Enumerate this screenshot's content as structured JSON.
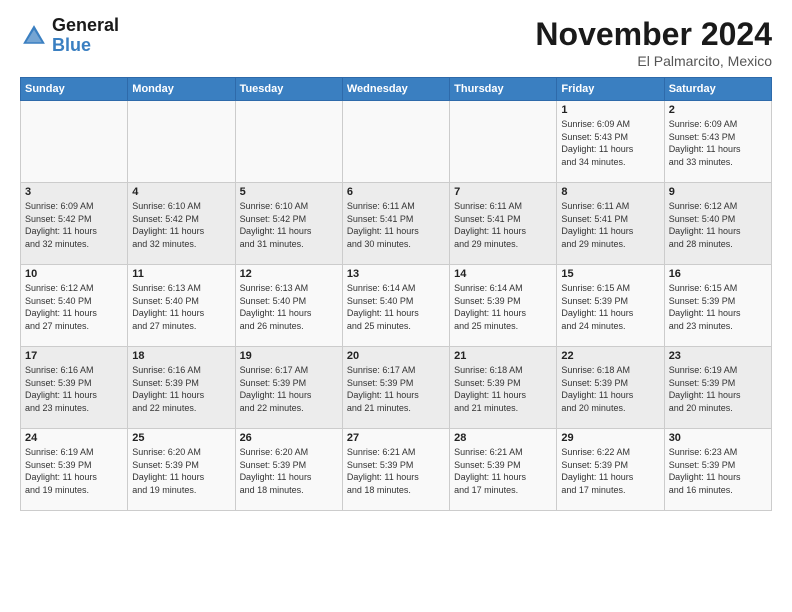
{
  "header": {
    "logo": {
      "line1": "General",
      "line2": "Blue"
    },
    "title": "November 2024",
    "subtitle": "El Palmarcito, Mexico"
  },
  "weekdays": [
    "Sunday",
    "Monday",
    "Tuesday",
    "Wednesday",
    "Thursday",
    "Friday",
    "Saturday"
  ],
  "weeks": [
    [
      {
        "day": "",
        "info": ""
      },
      {
        "day": "",
        "info": ""
      },
      {
        "day": "",
        "info": ""
      },
      {
        "day": "",
        "info": ""
      },
      {
        "day": "",
        "info": ""
      },
      {
        "day": "1",
        "info": "Sunrise: 6:09 AM\nSunset: 5:43 PM\nDaylight: 11 hours\nand 34 minutes."
      },
      {
        "day": "2",
        "info": "Sunrise: 6:09 AM\nSunset: 5:43 PM\nDaylight: 11 hours\nand 33 minutes."
      }
    ],
    [
      {
        "day": "3",
        "info": "Sunrise: 6:09 AM\nSunset: 5:42 PM\nDaylight: 11 hours\nand 32 minutes."
      },
      {
        "day": "4",
        "info": "Sunrise: 6:10 AM\nSunset: 5:42 PM\nDaylight: 11 hours\nand 32 minutes."
      },
      {
        "day": "5",
        "info": "Sunrise: 6:10 AM\nSunset: 5:42 PM\nDaylight: 11 hours\nand 31 minutes."
      },
      {
        "day": "6",
        "info": "Sunrise: 6:11 AM\nSunset: 5:41 PM\nDaylight: 11 hours\nand 30 minutes."
      },
      {
        "day": "7",
        "info": "Sunrise: 6:11 AM\nSunset: 5:41 PM\nDaylight: 11 hours\nand 29 minutes."
      },
      {
        "day": "8",
        "info": "Sunrise: 6:11 AM\nSunset: 5:41 PM\nDaylight: 11 hours\nand 29 minutes."
      },
      {
        "day": "9",
        "info": "Sunrise: 6:12 AM\nSunset: 5:40 PM\nDaylight: 11 hours\nand 28 minutes."
      }
    ],
    [
      {
        "day": "10",
        "info": "Sunrise: 6:12 AM\nSunset: 5:40 PM\nDaylight: 11 hours\nand 27 minutes."
      },
      {
        "day": "11",
        "info": "Sunrise: 6:13 AM\nSunset: 5:40 PM\nDaylight: 11 hours\nand 27 minutes."
      },
      {
        "day": "12",
        "info": "Sunrise: 6:13 AM\nSunset: 5:40 PM\nDaylight: 11 hours\nand 26 minutes."
      },
      {
        "day": "13",
        "info": "Sunrise: 6:14 AM\nSunset: 5:40 PM\nDaylight: 11 hours\nand 25 minutes."
      },
      {
        "day": "14",
        "info": "Sunrise: 6:14 AM\nSunset: 5:39 PM\nDaylight: 11 hours\nand 25 minutes."
      },
      {
        "day": "15",
        "info": "Sunrise: 6:15 AM\nSunset: 5:39 PM\nDaylight: 11 hours\nand 24 minutes."
      },
      {
        "day": "16",
        "info": "Sunrise: 6:15 AM\nSunset: 5:39 PM\nDaylight: 11 hours\nand 23 minutes."
      }
    ],
    [
      {
        "day": "17",
        "info": "Sunrise: 6:16 AM\nSunset: 5:39 PM\nDaylight: 11 hours\nand 23 minutes."
      },
      {
        "day": "18",
        "info": "Sunrise: 6:16 AM\nSunset: 5:39 PM\nDaylight: 11 hours\nand 22 minutes."
      },
      {
        "day": "19",
        "info": "Sunrise: 6:17 AM\nSunset: 5:39 PM\nDaylight: 11 hours\nand 22 minutes."
      },
      {
        "day": "20",
        "info": "Sunrise: 6:17 AM\nSunset: 5:39 PM\nDaylight: 11 hours\nand 21 minutes."
      },
      {
        "day": "21",
        "info": "Sunrise: 6:18 AM\nSunset: 5:39 PM\nDaylight: 11 hours\nand 21 minutes."
      },
      {
        "day": "22",
        "info": "Sunrise: 6:18 AM\nSunset: 5:39 PM\nDaylight: 11 hours\nand 20 minutes."
      },
      {
        "day": "23",
        "info": "Sunrise: 6:19 AM\nSunset: 5:39 PM\nDaylight: 11 hours\nand 20 minutes."
      }
    ],
    [
      {
        "day": "24",
        "info": "Sunrise: 6:19 AM\nSunset: 5:39 PM\nDaylight: 11 hours\nand 19 minutes."
      },
      {
        "day": "25",
        "info": "Sunrise: 6:20 AM\nSunset: 5:39 PM\nDaylight: 11 hours\nand 19 minutes."
      },
      {
        "day": "26",
        "info": "Sunrise: 6:20 AM\nSunset: 5:39 PM\nDaylight: 11 hours\nand 18 minutes."
      },
      {
        "day": "27",
        "info": "Sunrise: 6:21 AM\nSunset: 5:39 PM\nDaylight: 11 hours\nand 18 minutes."
      },
      {
        "day": "28",
        "info": "Sunrise: 6:21 AM\nSunset: 5:39 PM\nDaylight: 11 hours\nand 17 minutes."
      },
      {
        "day": "29",
        "info": "Sunrise: 6:22 AM\nSunset: 5:39 PM\nDaylight: 11 hours\nand 17 minutes."
      },
      {
        "day": "30",
        "info": "Sunrise: 6:23 AM\nSunset: 5:39 PM\nDaylight: 11 hours\nand 16 minutes."
      }
    ]
  ]
}
